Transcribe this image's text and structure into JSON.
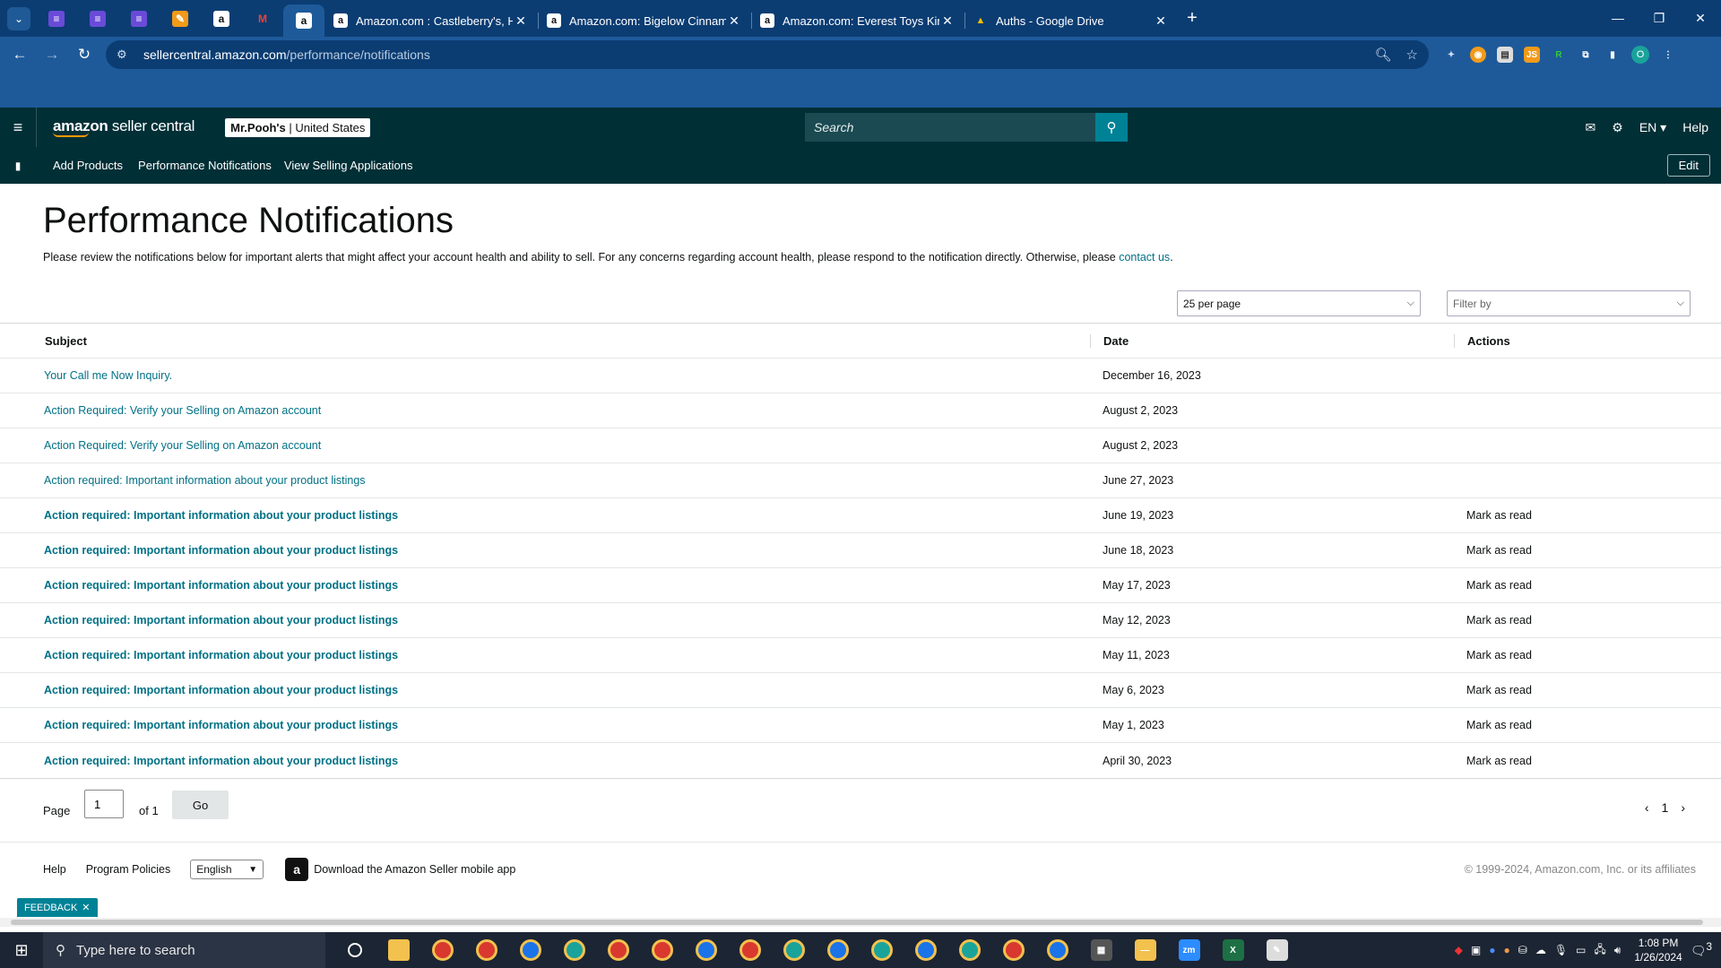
{
  "browser": {
    "tabs": [
      {
        "title": "Amazon.com : Castleberry's, Ho",
        "favicon": "a"
      },
      {
        "title": "Amazon.com: Bigelow Cinnamo",
        "favicon": "a"
      },
      {
        "title": "Amazon.com: Everest Toys King",
        "favicon": "a"
      },
      {
        "title": "Auths - Google Drive",
        "favicon": "▲"
      }
    ],
    "url_host": "sellercentral.amazon.com",
    "url_path": "/performance/notifications"
  },
  "header": {
    "logo_brand": "amazon",
    "logo_suffix": " seller central",
    "store_name": "Mr.Pooh's",
    "store_region": " | United States",
    "search_placeholder": "Search",
    "lang": "EN ▾",
    "help": "Help"
  },
  "nav": {
    "links": [
      "Add Products",
      "Performance Notifications",
      "View Selling Applications"
    ],
    "edit": "Edit"
  },
  "page": {
    "title": "Performance Notifications",
    "intro": "Please review the notifications below for important alerts that might affect your account health and ability to sell. For any concerns regarding account health, please respond to the notification directly. Otherwise, please ",
    "intro_link": "contact us",
    "intro_end": ".",
    "per_page": "25 per page",
    "filter_placeholder": "Filter by"
  },
  "table": {
    "headers": {
      "subject": "Subject",
      "date": "Date",
      "actions": "Actions"
    },
    "rows": [
      {
        "subject": "Your Call me Now Inquiry.",
        "date": "December 16, 2023",
        "action": "",
        "unread": false
      },
      {
        "subject": "Action Required: Verify your Selling on Amazon account",
        "date": "August 2, 2023",
        "action": "",
        "unread": false
      },
      {
        "subject": "Action Required: Verify your Selling on Amazon account",
        "date": "August 2, 2023",
        "action": "",
        "unread": false
      },
      {
        "subject": "Action required: Important information about your product listings",
        "date": "June 27, 2023",
        "action": "",
        "unread": false
      },
      {
        "subject": "Action required: Important information about your product listings",
        "date": "June 19, 2023",
        "action": "Mark as read",
        "unread": true
      },
      {
        "subject": "Action required: Important information about your product listings",
        "date": "June 18, 2023",
        "action": "Mark as read",
        "unread": true
      },
      {
        "subject": "Action required: Important information about your product listings",
        "date": "May 17, 2023",
        "action": "Mark as read",
        "unread": true
      },
      {
        "subject": "Action required: Important information about your product listings",
        "date": "May 12, 2023",
        "action": "Mark as read",
        "unread": true
      },
      {
        "subject": "Action required: Important information about your product listings",
        "date": "May 11, 2023",
        "action": "Mark as read",
        "unread": true
      },
      {
        "subject": "Action required: Important information about your product listings",
        "date": "May 6, 2023",
        "action": "Mark as read",
        "unread": true
      },
      {
        "subject": "Action required: Important information about your product listings",
        "date": "May 1, 2023",
        "action": "Mark as read",
        "unread": true
      },
      {
        "subject": "Action required: Important information about your product listings",
        "date": "April 30, 2023",
        "action": "Mark as read",
        "unread": true
      }
    ]
  },
  "pager": {
    "label": "Page",
    "value": "1",
    "of": "of 1",
    "go": "Go",
    "current": "1"
  },
  "footer": {
    "help": "Help",
    "policies": "Program Policies",
    "language": "English",
    "app_text": "Download the Amazon Seller mobile app",
    "copyright": "© 1999-2024, Amazon.com, Inc. or its affiliates"
  },
  "feedback": "FEEDBACK",
  "taskbar": {
    "search_placeholder": "Type here to search",
    "time": "1:08 PM",
    "date": "1/26/2024",
    "notifications": "3"
  },
  "colors": {
    "header_bg": "#002f36",
    "link": "#007185",
    "accent": "#008296"
  }
}
